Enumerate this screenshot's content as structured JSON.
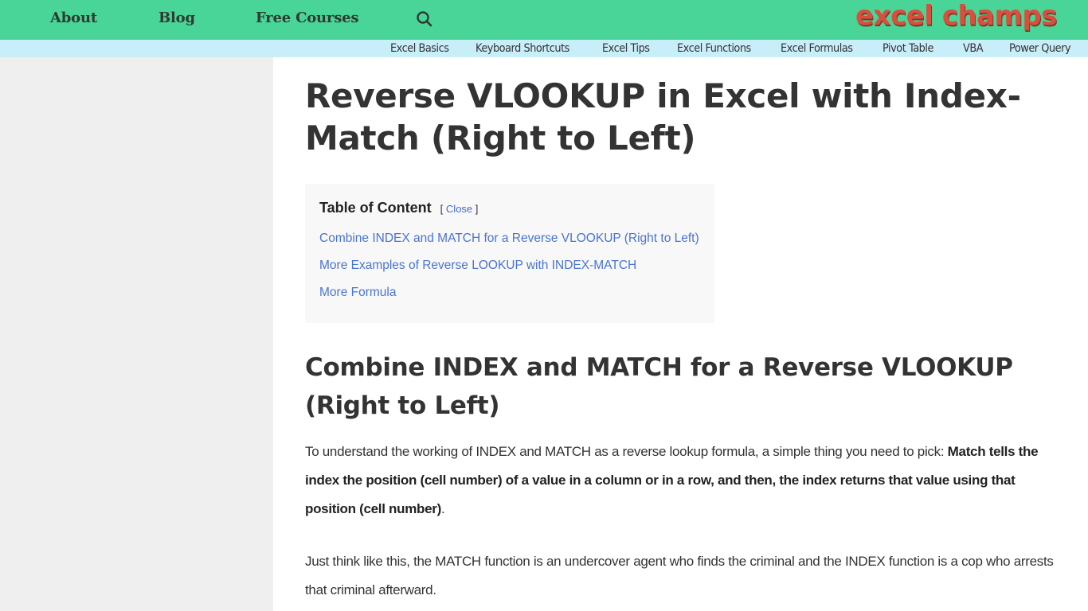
{
  "header": {
    "nav": [
      {
        "label": "About"
      },
      {
        "label": "Blog"
      },
      {
        "label": "Free Courses"
      }
    ],
    "search_icon": "search-icon",
    "logo_text": "excel champs"
  },
  "subnav": {
    "items": [
      {
        "label": "Excel Basics"
      },
      {
        "label": "Keyboard Shortcuts"
      },
      {
        "label": "Excel Tips"
      },
      {
        "label": "Excel Functions"
      },
      {
        "label": "Excel Formulas"
      },
      {
        "label": "Pivot Table"
      },
      {
        "label": "VBA"
      },
      {
        "label": "Power Query"
      }
    ]
  },
  "article": {
    "title": "Reverse VLOOKUP in Excel with Index-Match (Right to Left)",
    "toc": {
      "heading": "Table of Content",
      "bracket_open": "[",
      "close_label": "Close",
      "bracket_close": "]",
      "items": [
        {
          "label": "Combine INDEX and MATCH for a Reverse VLOOKUP (Right to Left)"
        },
        {
          "label": "More Examples of Reverse LOOKUP with INDEX-MATCH"
        },
        {
          "label": "More Formula"
        }
      ]
    },
    "section_title": "Combine INDEX and MATCH for a Reverse VLOOKUP (Right to Left)",
    "paragraph1": {
      "intro": "To understand the working of INDEX and MATCH as a reverse lookup formula, a simple thing you need to pick: ",
      "bold": "Match tells the index the position (cell number) of a value in a column or in a row, and then, the index returns that value using that position (cell number)",
      "end": "."
    },
    "paragraph2": "Just think like this, the MATCH function is an undercover agent who finds the criminal and the INDEX function is a cop who arrests that criminal afterward."
  },
  "colors": {
    "header_bg": "#48d597",
    "subnav_bg": "#c8eef9",
    "logo": "#d94f3d",
    "link": "#4a75cc",
    "sidebar_bg": "#efefef"
  }
}
